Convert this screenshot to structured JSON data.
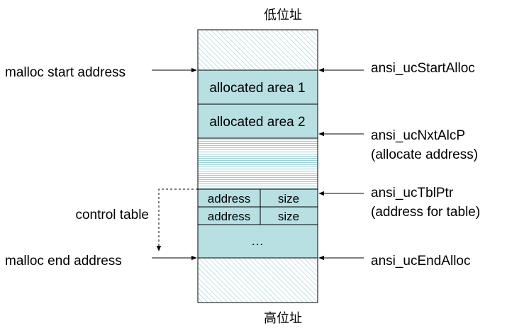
{
  "header": {
    "top_label": "低位址",
    "bottom_label": "高位址"
  },
  "memory": {
    "allocated_area_1": "allocated area 1",
    "allocated_area_2": "allocated area 2",
    "table_rows": [
      {
        "address": "address",
        "size": "size"
      },
      {
        "address": "address",
        "size": "size"
      }
    ],
    "ellipsis": "…"
  },
  "left_labels": {
    "malloc_start": "malloc start address",
    "control_table": "control table",
    "malloc_end": "malloc end address"
  },
  "right_labels": {
    "start_alloc": "ansi_ucStartAlloc",
    "nxt_alc_p": "ansi_ucNxtAlcP",
    "nxt_alc_p_note": "(allocate address)",
    "tbl_ptr": "ansi_ucTblPtr",
    "tbl_ptr_note": "(address for table)",
    "end_alloc": "ansi_ucEndAlloc"
  },
  "colors": {
    "cyan_fill": "#b8dfe2",
    "hatch_line": "#9ccfd3",
    "border": "#000000"
  }
}
